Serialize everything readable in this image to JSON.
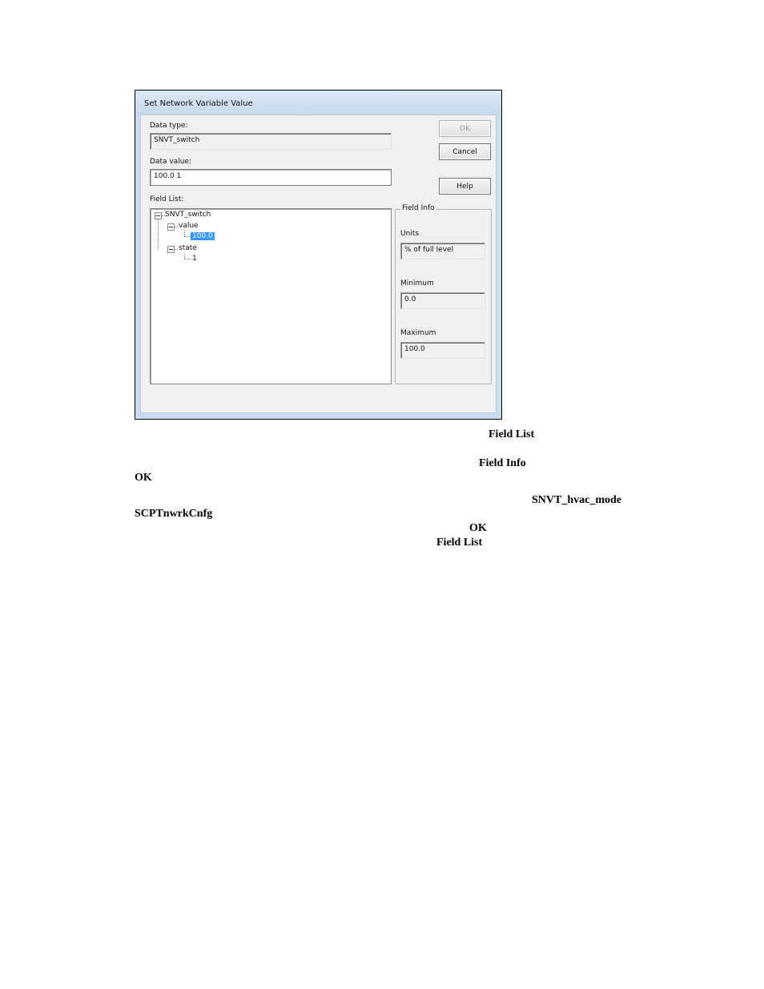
{
  "dialog": {
    "title": "Set Network Variable Value",
    "data_type_label": "Data type:",
    "data_type_value": "SNVT_switch",
    "data_value_label": "Data value:",
    "data_value": "100.0 1",
    "field_list_label": "Field List:",
    "buttons": {
      "ok": "OK",
      "cancel": "Cancel",
      "help": "Help"
    },
    "tree": {
      "root": "SNVT_switch",
      "value_node": "value",
      "value_leaf": "100.0",
      "state_node": "state",
      "state_leaf": "1"
    },
    "field_info": {
      "title": "Field Info",
      "units_label": "Units",
      "units_value": "% of full level",
      "minimum_label": "Minimum",
      "minimum_value": "0.0",
      "maximum_label": "Maximum",
      "maximum_value": "100.0"
    }
  },
  "document": {
    "fragments": [
      "Field List",
      "Field Info",
      "OK",
      "SNVT_hvac_mode",
      "SCPTnwrkCnfg",
      "OK",
      "Field List"
    ]
  }
}
